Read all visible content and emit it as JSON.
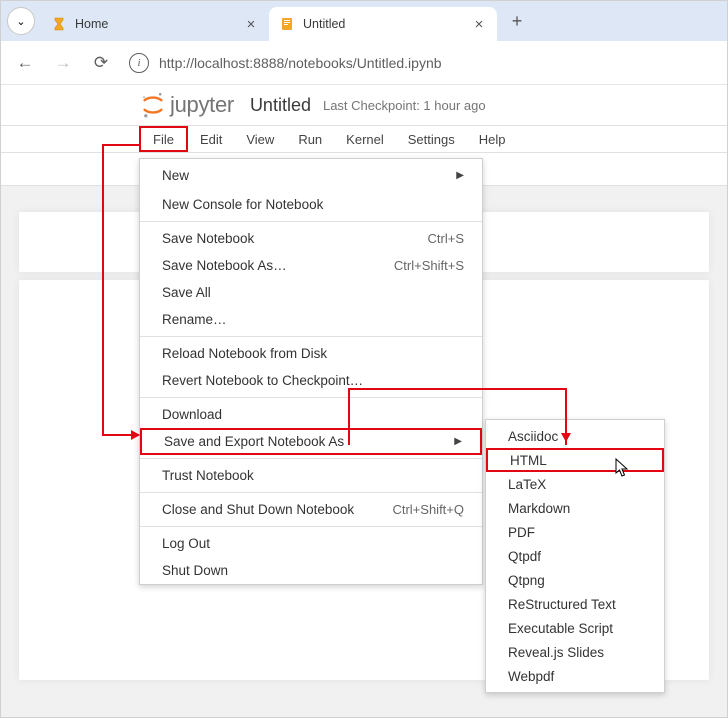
{
  "browser": {
    "tabs": [
      {
        "title": "Home",
        "active": false
      },
      {
        "title": "Untitled",
        "active": true
      }
    ],
    "url": "http://localhost:8888/notebooks/Untitled.ipynb"
  },
  "jupyter": {
    "brand": "jupyter",
    "notebook_title": "Untitled",
    "checkpoint": "Last Checkpoint: 1 hour ago"
  },
  "menubar": [
    "File",
    "Edit",
    "View",
    "Run",
    "Kernel",
    "Settings",
    "Help"
  ],
  "file_menu": [
    {
      "label": "New",
      "submenu": true
    },
    {
      "label": "New Console for Notebook"
    },
    {
      "sep": true
    },
    {
      "label": "Save Notebook",
      "shortcut": "Ctrl+S"
    },
    {
      "label": "Save Notebook As…",
      "shortcut": "Ctrl+Shift+S"
    },
    {
      "label": "Save All"
    },
    {
      "label": "Rename…"
    },
    {
      "sep": true
    },
    {
      "label": "Reload Notebook from Disk"
    },
    {
      "label": "Revert Notebook to Checkpoint…"
    },
    {
      "sep": true
    },
    {
      "label": "Download"
    },
    {
      "label": "Save and Export Notebook As",
      "submenu": true,
      "highlighted": true
    },
    {
      "sep": true
    },
    {
      "label": "Trust Notebook"
    },
    {
      "sep": true
    },
    {
      "label": "Close and Shut Down Notebook",
      "shortcut": "Ctrl+Shift+Q"
    },
    {
      "sep": true
    },
    {
      "label": "Log Out"
    },
    {
      "label": "Shut Down"
    }
  ],
  "export_menu": [
    {
      "label": "Asciidoc"
    },
    {
      "label": "HTML",
      "highlighted": true
    },
    {
      "label": "LaTeX"
    },
    {
      "label": "Markdown"
    },
    {
      "label": "PDF"
    },
    {
      "label": "Qtpdf"
    },
    {
      "label": "Qtpng"
    },
    {
      "label": "ReStructured Text"
    },
    {
      "label": "Executable Script"
    },
    {
      "label": "Reveal.js Slides"
    },
    {
      "label": "Webpdf"
    }
  ]
}
